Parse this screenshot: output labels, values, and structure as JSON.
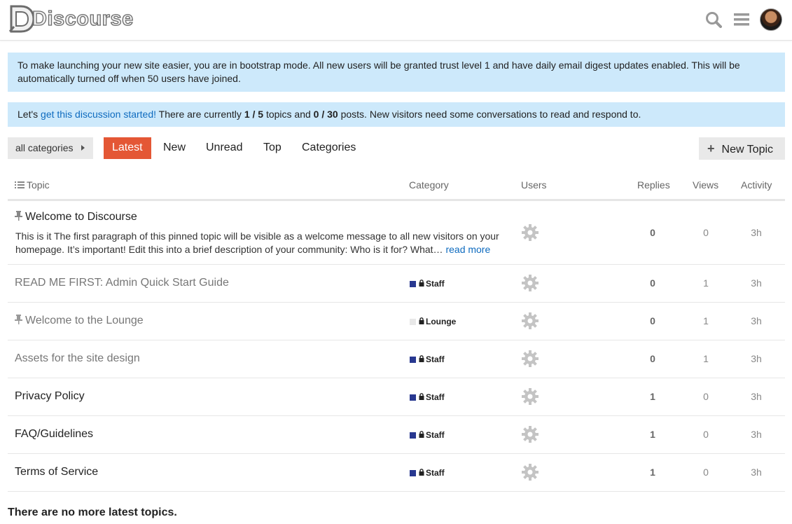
{
  "header": {
    "logo_text": "Discourse",
    "icons": [
      "search-icon",
      "hamburger-menu-icon",
      "user-avatar"
    ]
  },
  "banners": {
    "bootstrap": "To make launching your new site easier, you are in bootstrap mode. All new users will be granted trust level 1 and have daily email digest updates enabled. This will be automatically turned off when 50 users have joined.",
    "discussion_prefix": "Let's ",
    "discussion_link": "get this discussion started!",
    "discussion_mid1": " There are currently ",
    "topics_count": "1 / 5",
    "discussion_mid2": " topics and ",
    "posts_count": "0 / 30",
    "discussion_suffix": " posts. New visitors need some conversations to read and respond to."
  },
  "nav": {
    "category_dropdown": "all categories",
    "tabs": [
      "Latest",
      "New",
      "Unread",
      "Top",
      "Categories"
    ],
    "active_tab": "Latest",
    "new_topic_label": "New Topic"
  },
  "table": {
    "headers": {
      "topic": "Topic",
      "category": "Category",
      "users": "Users",
      "replies": "Replies",
      "views": "Views",
      "activity": "Activity"
    },
    "rows": [
      {
        "title": "Welcome to Discourse",
        "pinned": true,
        "excerpt": "This is it The first paragraph of this pinned topic will be visible as a welcome message to all new visitors on your homepage. It’s important! Edit this into a brief description of your community: Who is it for? What… ",
        "read_more": "read more",
        "category": "",
        "replies": "0",
        "views": "0",
        "activity": "3h"
      },
      {
        "title": "READ ME FIRST: Admin Quick Start Guide",
        "category": "Staff",
        "category_color": "#283890",
        "replies": "0",
        "views": "1",
        "activity": "3h"
      },
      {
        "title": "Welcome to the Lounge",
        "pinned_icon": true,
        "category": "Lounge",
        "category_color": "#e8e8e8",
        "replies": "0",
        "views": "1",
        "activity": "3h"
      },
      {
        "title": "Assets for the site design",
        "category": "Staff",
        "category_color": "#283890",
        "replies": "0",
        "views": "1",
        "activity": "3h"
      },
      {
        "title": "Privacy Policy",
        "category": "Staff",
        "category_color": "#283890",
        "replies": "1",
        "views": "0",
        "activity": "3h"
      },
      {
        "title": "FAQ/Guidelines",
        "category": "Staff",
        "category_color": "#283890",
        "replies": "1",
        "views": "0",
        "activity": "3h"
      },
      {
        "title": "Terms of Service",
        "category": "Staff",
        "category_color": "#283890",
        "replies": "1",
        "views": "0",
        "activity": "3h"
      }
    ]
  },
  "footer": {
    "message": "There are no more latest topics."
  },
  "colors": {
    "accent": "#e45735",
    "banner": "#cde9fb",
    "link": "#0e6bbf",
    "staff": "#283890"
  }
}
